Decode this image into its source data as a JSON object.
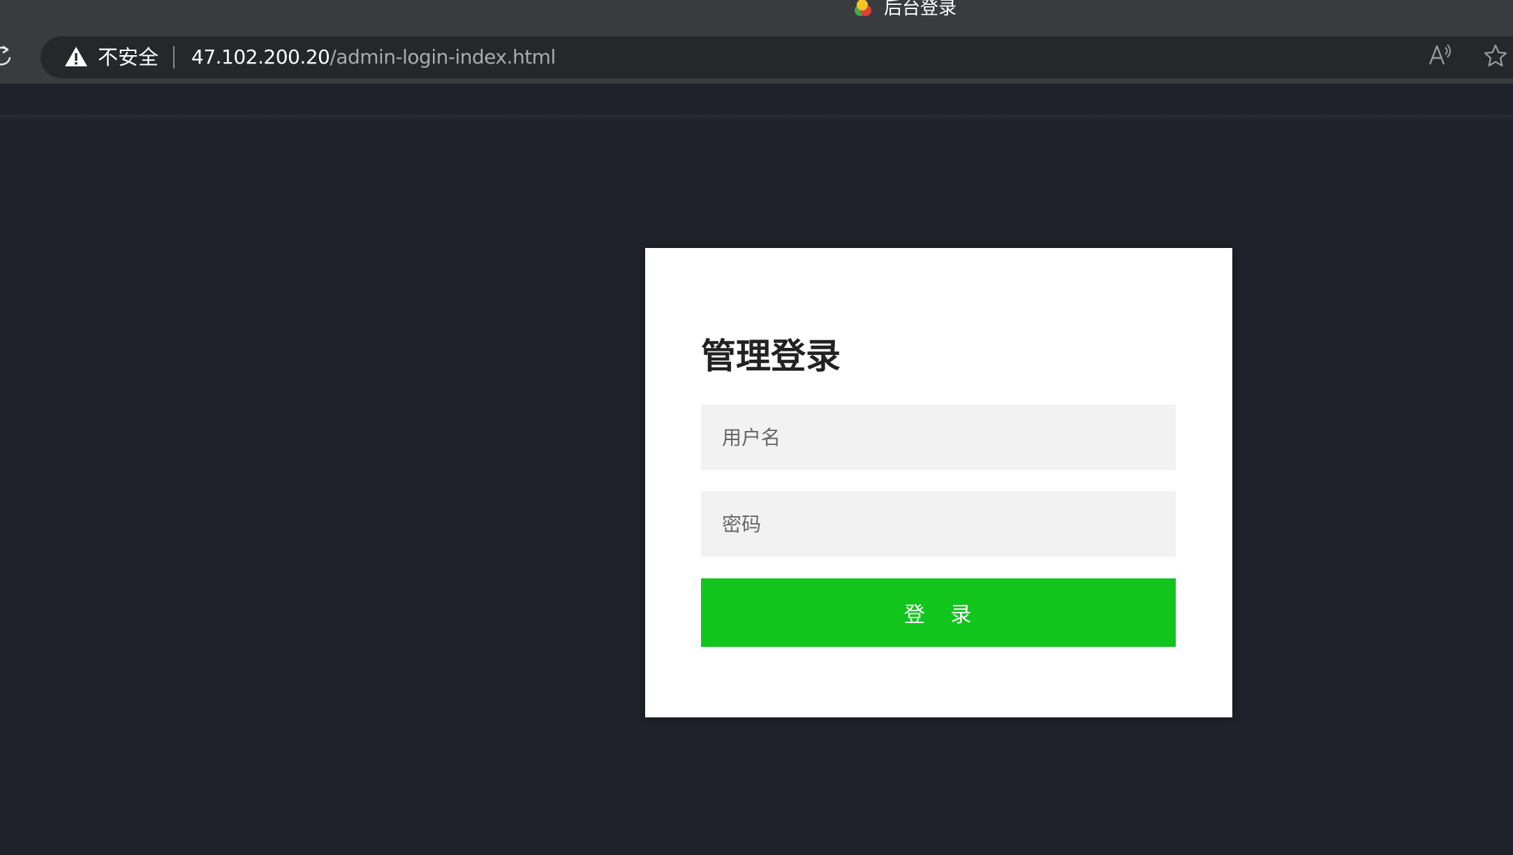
{
  "browser": {
    "tab": {
      "title": "后台登录"
    },
    "address_bar": {
      "security_label": "不安全",
      "url_host": "47.102.200.20",
      "url_path": "/admin-login-index.html"
    },
    "icons": {
      "reload": "reload-icon",
      "warning": "warning-icon",
      "read_aloud": "read-aloud-icon",
      "favorite": "star-icon",
      "favicon": "site-favicon"
    }
  },
  "login": {
    "title": "管理登录",
    "username_placeholder": "用户名",
    "password_placeholder": "密码",
    "submit_label": "登   录"
  },
  "colors": {
    "page_background": "#1f222a",
    "chrome_background": "#3a3b3e",
    "address_bar_background": "#26272a",
    "card_background": "#ffffff",
    "input_background": "#f2f2f2",
    "button_accent": "#11c51d"
  }
}
